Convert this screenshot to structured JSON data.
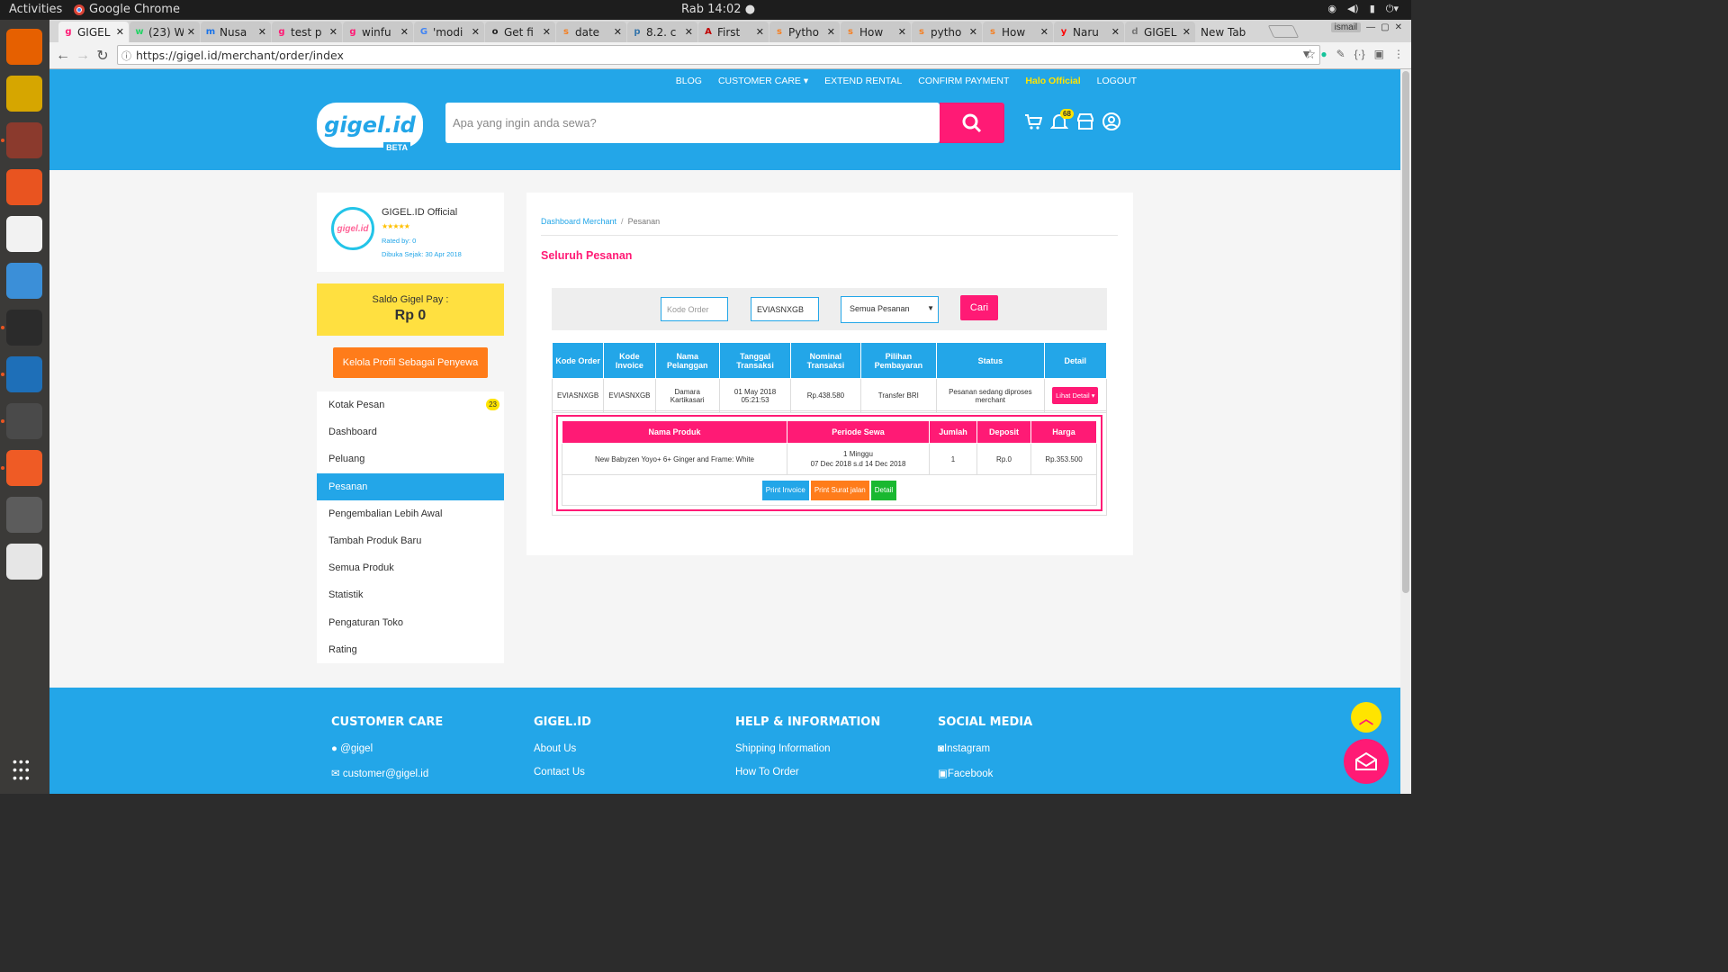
{
  "os": {
    "activities": "Activities",
    "app_name": "Google Chrome",
    "clock": "Rab 14:02 ●",
    "user": "ismail"
  },
  "dock": [
    {
      "name": "firefox-icon",
      "color": "#e66000"
    },
    {
      "name": "rhythmbox-icon",
      "color": "#d6a600"
    },
    {
      "name": "files-icon",
      "color": "#8b3a2d"
    },
    {
      "name": "software-center-icon",
      "color": "#e95420"
    },
    {
      "name": "amazon-icon",
      "color": "#f2f2f2"
    },
    {
      "name": "help-icon",
      "color": "#3b8fd8"
    },
    {
      "name": "terminal-icon",
      "color": "#2b2b2b"
    },
    {
      "name": "vscode-icon",
      "color": "#1e6fb8"
    },
    {
      "name": "chrome-icon",
      "color": "#4a4a4a"
    },
    {
      "name": "postman-icon",
      "color": "#ef5b25"
    },
    {
      "name": "mysql-workbench-icon",
      "color": "#5c5c5c"
    },
    {
      "name": "text-editor-icon",
      "color": "#e6e6e6"
    }
  ],
  "tabs": [
    {
      "title": "GIGEL",
      "icon": "g",
      "color": "#ff1a75",
      "active": true
    },
    {
      "title": "(23) W",
      "icon": "w",
      "color": "#25d366"
    },
    {
      "title": "Nusa",
      "icon": "m",
      "color": "#1a73e8"
    },
    {
      "title": "test p",
      "icon": "g",
      "color": "#ff1a75"
    },
    {
      "title": "winfu",
      "icon": "g",
      "color": "#ff1a75"
    },
    {
      "title": "'modi",
      "icon": "G",
      "color": "#4285f4"
    },
    {
      "title": "Get fi",
      "icon": "o",
      "color": "#222222"
    },
    {
      "title": "date",
      "icon": "s",
      "color": "#f48024"
    },
    {
      "title": "8.2. c",
      "icon": "p",
      "color": "#3776ab"
    },
    {
      "title": "First",
      "icon": "A",
      "color": "#c00000"
    },
    {
      "title": "Pytho",
      "icon": "s",
      "color": "#f48024"
    },
    {
      "title": "How",
      "icon": "s",
      "color": "#f48024"
    },
    {
      "title": "pytho",
      "icon": "s",
      "color": "#f48024"
    },
    {
      "title": "How",
      "icon": "s",
      "color": "#f48024"
    },
    {
      "title": "Naru",
      "icon": "y",
      "color": "#ff0000"
    },
    {
      "title": "GIGEL",
      "icon": "d",
      "color": "#777777"
    },
    {
      "title": "New Tab",
      "icon": "",
      "color": "#d6d6d6"
    }
  ],
  "url": "https://gigel.id/merchant/order/index",
  "header": {
    "nav": [
      "BLOG",
      "CUSTOMER CARE ▾",
      "EXTEND RENTAL",
      "CONFIRM PAYMENT",
      "Halo Official",
      "LOGOUT"
    ],
    "logo": "gigel.id",
    "beta": "BETA",
    "search_placeholder": "Apa yang ingin anda sewa?",
    "notif_count": "68"
  },
  "store": {
    "name": "GIGEL.ID Official",
    "avatar": "gigel.id",
    "stars": "★★★★★",
    "rated": "Rated by: 0",
    "since": "Dibuka Sejak: 30 Apr 2018"
  },
  "saldo": {
    "label": "Saldo Gigel Pay :",
    "value": "Rp 0"
  },
  "kelola_label": "Kelola Profil Sebagai Penyewa",
  "menu": [
    {
      "label": "Kotak Pesan",
      "badge": "23"
    },
    {
      "label": "Dashboard"
    },
    {
      "label": "Peluang"
    },
    {
      "label": "Pesanan",
      "active": true
    },
    {
      "label": "Pengembalian Lebih Awal"
    },
    {
      "label": "Tambah Produk Baru"
    },
    {
      "label": "Semua Produk"
    },
    {
      "label": "Statistik"
    },
    {
      "label": "Pengaturan Toko"
    },
    {
      "label": "Rating"
    }
  ],
  "breadcrumb": {
    "root": "Dashboard Merchant",
    "sep": "/",
    "current": "Pesanan"
  },
  "page_title": "Seluruh Pesanan",
  "filter": {
    "order_placeholder": "Kode Order",
    "invoice_value": "EVIASNXGB",
    "status_value": "Semua Pesanan",
    "cari": "Cari"
  },
  "orders": {
    "headers": [
      "Kode Order",
      "Kode Invoice",
      "Nama Pelanggan",
      "Tanggal Transaksi",
      "Nominal Transaksi",
      "Pilihan Pembayaran",
      "Status",
      "Detail"
    ],
    "row": {
      "order": "EVIASNXGB",
      "invoice": "EVIASNXGB",
      "customer": "Damara Kartikasari",
      "date": "01 May 2018 05:21:53",
      "nominal": "Rp.438.580",
      "payment": "Transfer BRI",
      "status": "Pesanan sedang diproses merchant",
      "detail": "Lihat Detail ▾"
    }
  },
  "products": {
    "headers": [
      "Nama Produk",
      "Periode Sewa",
      "Jumlah",
      "Deposit",
      "Harga"
    ],
    "row": {
      "name": "New Babyzen Yoyo+ 6+ Ginger and Frame: White",
      "period": "1 Minggu",
      "period_dates": "07 Dec 2018 s.d 14 Dec 2018",
      "qty": "1",
      "deposit": "Rp.0",
      "price": "Rp.353.500"
    },
    "actions": {
      "print_invoice": "Print Invoice",
      "print_surat": "Print Surat jalan",
      "detail": "Detail"
    }
  },
  "footer": {
    "cols": [
      {
        "title": "CUSTOMER CARE",
        "links": [
          "@gigel",
          "customer@gigel.id"
        ]
      },
      {
        "title": "GIGEL.ID",
        "links": [
          "About Us",
          "Contact Us"
        ]
      },
      {
        "title": "HELP & INFORMATION",
        "links": [
          "Shipping Information",
          "How To Order"
        ]
      },
      {
        "title": "SOCIAL MEDIA",
        "links": [
          "Instagram",
          "Facebook"
        ]
      }
    ]
  },
  "colors": {
    "brand_blue": "#23a6e8",
    "brand_pink": "#ff1a75",
    "yellow": "#ffe400",
    "orange": "#ff7c1a",
    "green": "#19b830"
  }
}
